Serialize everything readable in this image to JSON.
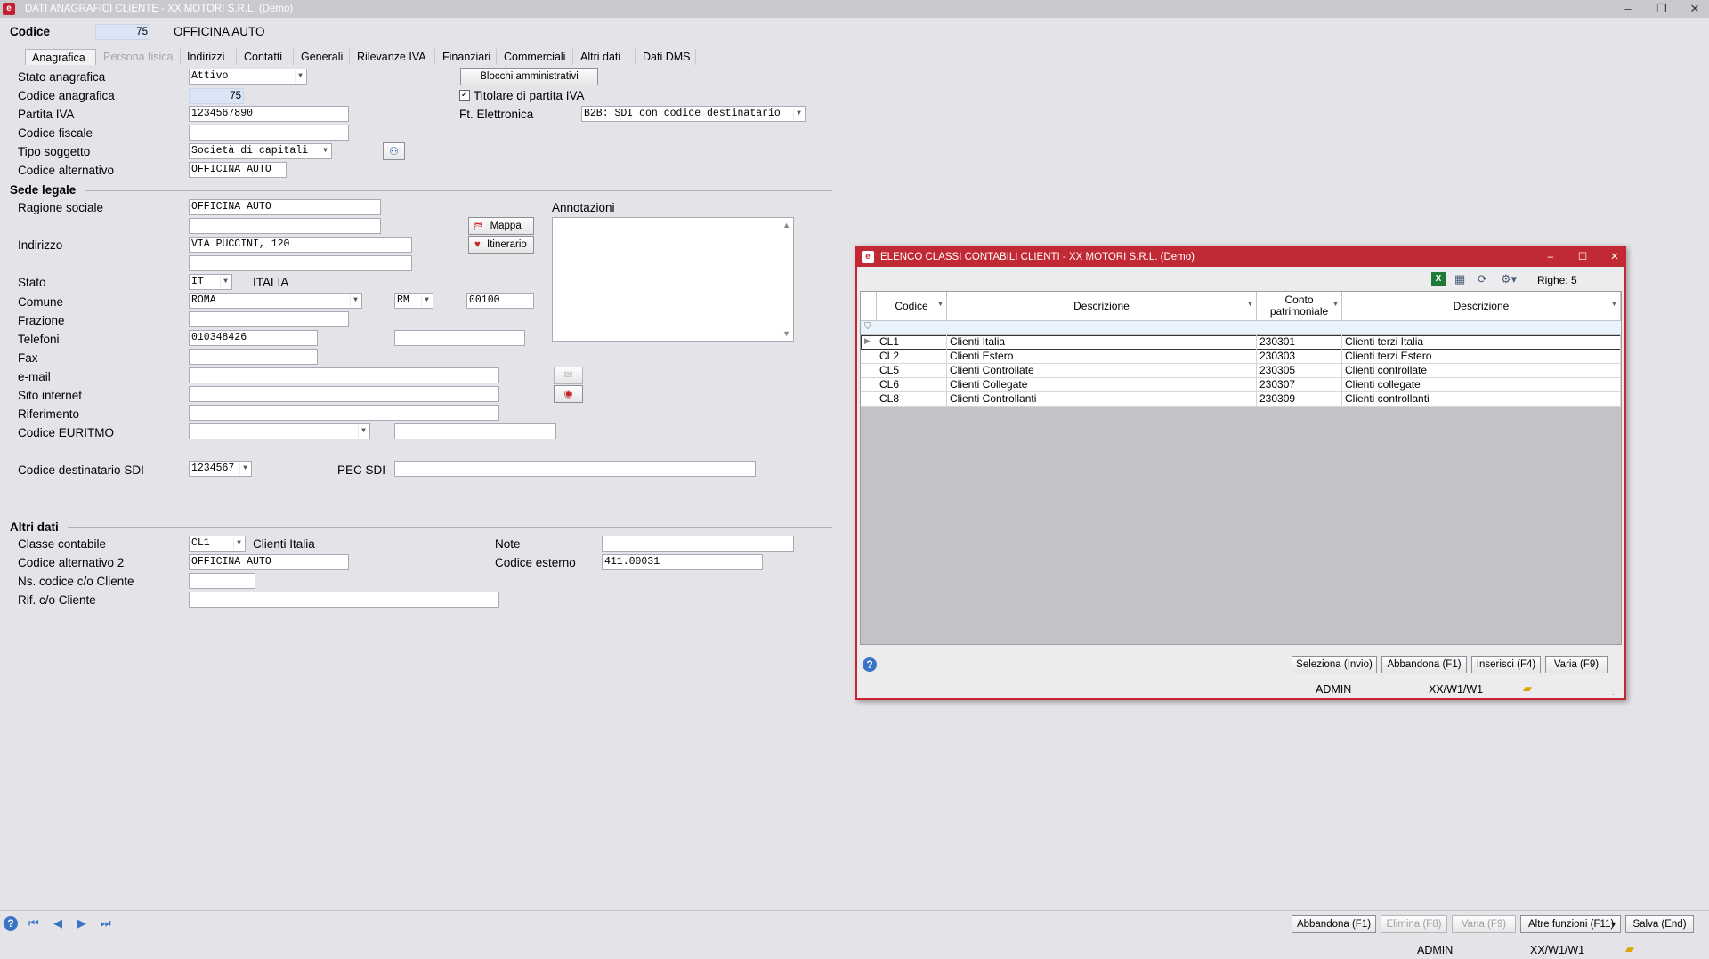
{
  "window": {
    "title": "DATI ANAGRAFICI CLIENTE  - XX  MOTORI S.R.L.  (Demo)"
  },
  "header": {
    "codice_label": "Codice",
    "codice_value": "75",
    "name": "OFFICINA AUTO"
  },
  "tabs": [
    {
      "label": "Anagrafica",
      "state": "active"
    },
    {
      "label": "Persona fisica",
      "state": "disabled"
    },
    {
      "label": "Indirizzi"
    },
    {
      "label": "Contatti"
    },
    {
      "label": "Generali"
    },
    {
      "label": "Rilevanze IVA"
    },
    {
      "label": "Finanziari"
    },
    {
      "label": "Commerciali"
    },
    {
      "label": "Altri dati"
    },
    {
      "label": "Dati DMS"
    }
  ],
  "form": {
    "stato_anagrafica": {
      "label": "Stato anagrafica",
      "value": "Attivo"
    },
    "codice_anagrafica": {
      "label": "Codice anagrafica",
      "value": "75"
    },
    "partita_iva": {
      "label": "Partita IVA",
      "value": "1234567890"
    },
    "codice_fiscale": {
      "label": "Codice fiscale",
      "value": ""
    },
    "tipo_soggetto": {
      "label": "Tipo soggetto",
      "value": "Società di capitali"
    },
    "codice_alternativo": {
      "label": "Codice alternativo",
      "value": "OFFICINA AUTO"
    },
    "blocchi_button": "Blocchi amministrativi",
    "titolare_iva": {
      "label": "Titolare di partita IVA",
      "checked": true
    },
    "ft_elettronica": {
      "label": "Ft. Elettronica",
      "value": "B2B: SDI con codice destinatario"
    }
  },
  "sede_legale": {
    "title": "Sede legale",
    "ragione_sociale": {
      "label": "Ragione sociale",
      "value": "OFFICINA AUTO",
      "value2": ""
    },
    "indirizzo": {
      "label": "Indirizzo",
      "value": "VIA PUCCINI, 120",
      "value2": ""
    },
    "mappa_button": "Mappa",
    "itinerario_button": "Itinerario",
    "annotazioni_label": "Annotazioni",
    "stato": {
      "label": "Stato",
      "code": "IT",
      "name": "ITALIA"
    },
    "comune": {
      "label": "Comune",
      "value": "ROMA",
      "provincia": "RM",
      "cap": "00100"
    },
    "frazione": {
      "label": "Frazione",
      "value": ""
    },
    "telefoni": {
      "label": "Telefoni",
      "value": "010348426",
      "value2": ""
    },
    "fax": {
      "label": "Fax",
      "value": ""
    },
    "email": {
      "label": "e-mail",
      "value": ""
    },
    "sito": {
      "label": "Sito internet",
      "value": ""
    },
    "riferimento": {
      "label": "Riferimento",
      "value": ""
    },
    "euritmo": {
      "label": "Codice EURITMO",
      "value": "",
      "value2": ""
    },
    "sdi": {
      "label": "Codice destinatario SDI",
      "value": "1234567"
    },
    "pec": {
      "label": "PEC SDI",
      "value": ""
    }
  },
  "altri_dati": {
    "title": "Altri dati",
    "classe": {
      "label": "Classe contabile",
      "value": "CL1",
      "desc": "Clienti Italia"
    },
    "note": {
      "label": "Note",
      "value": ""
    },
    "codice_alt2": {
      "label": "Codice alternativo 2",
      "value": "OFFICINA AUTO"
    },
    "codice_esterno": {
      "label": "Codice esterno",
      "value": "411.00031"
    },
    "ns_codice": {
      "label": "Ns. codice c/o Cliente",
      "value": ""
    },
    "rif": {
      "label": "Rif. c/o Cliente",
      "value": ""
    }
  },
  "footer": {
    "buttons": {
      "abbandona": "Abbandona (F1)",
      "elimina": "Elimina (F8)",
      "varia": "Varia (F9)",
      "altre": "Altre funzioni (F11)",
      "salva": "Salva (End)"
    },
    "status": {
      "user": "ADMIN",
      "path": "XX/W1/W1"
    }
  },
  "modal": {
    "title": "ELENCO CLASSI CONTABILI CLIENTI - XX  MOTORI S.R.L.  (Demo)",
    "righe": "Righe: 5",
    "columns": [
      "Codice",
      "Descrizione",
      "Conto patrimoniale",
      "Descrizione"
    ],
    "rows": [
      {
        "codice": "CL1",
        "descrizione": "Clienti Italia",
        "conto": "230301",
        "descrizione2": "Clienti terzi Italia"
      },
      {
        "codice": "CL2",
        "descrizione": "Clienti Estero",
        "conto": "230303",
        "descrizione2": "Clienti terzi Estero"
      },
      {
        "codice": "CL5",
        "descrizione": "Clienti Controllate",
        "conto": "230305",
        "descrizione2": "Clienti controllate"
      },
      {
        "codice": "CL6",
        "descrizione": "Clienti Collegate",
        "conto": "230307",
        "descrizione2": "Clienti collegate"
      },
      {
        "codice": "CL8",
        "descrizione": "Clienti Controllanti",
        "conto": "230309",
        "descrizione2": "Clienti controllanti"
      }
    ],
    "buttons": {
      "seleziona": "Seleziona (Invio)",
      "abbandona": "Abbandona (F1)",
      "inserisci": "Inserisci (F4)",
      "varia": "Varia (F9)"
    },
    "status": {
      "user": "ADMIN",
      "path": "XX/W1/W1"
    }
  },
  "colors": {
    "accent": "#c12a35",
    "field_blue": "#d9e5f4",
    "background": "#e4e4e8"
  }
}
